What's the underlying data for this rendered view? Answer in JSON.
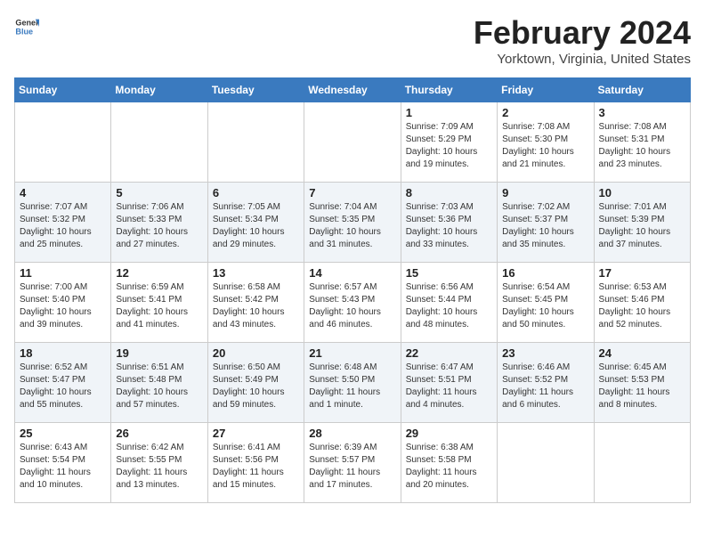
{
  "header": {
    "logo_general": "General",
    "logo_blue": "Blue",
    "title": "February 2024",
    "location": "Yorktown, Virginia, United States"
  },
  "weekdays": [
    "Sunday",
    "Monday",
    "Tuesday",
    "Wednesday",
    "Thursday",
    "Friday",
    "Saturday"
  ],
  "weeks": [
    [
      {
        "day": "",
        "info": ""
      },
      {
        "day": "",
        "info": ""
      },
      {
        "day": "",
        "info": ""
      },
      {
        "day": "",
        "info": ""
      },
      {
        "day": "1",
        "info": "Sunrise: 7:09 AM\nSunset: 5:29 PM\nDaylight: 10 hours\nand 19 minutes."
      },
      {
        "day": "2",
        "info": "Sunrise: 7:08 AM\nSunset: 5:30 PM\nDaylight: 10 hours\nand 21 minutes."
      },
      {
        "day": "3",
        "info": "Sunrise: 7:08 AM\nSunset: 5:31 PM\nDaylight: 10 hours\nand 23 minutes."
      }
    ],
    [
      {
        "day": "4",
        "info": "Sunrise: 7:07 AM\nSunset: 5:32 PM\nDaylight: 10 hours\nand 25 minutes."
      },
      {
        "day": "5",
        "info": "Sunrise: 7:06 AM\nSunset: 5:33 PM\nDaylight: 10 hours\nand 27 minutes."
      },
      {
        "day": "6",
        "info": "Sunrise: 7:05 AM\nSunset: 5:34 PM\nDaylight: 10 hours\nand 29 minutes."
      },
      {
        "day": "7",
        "info": "Sunrise: 7:04 AM\nSunset: 5:35 PM\nDaylight: 10 hours\nand 31 minutes."
      },
      {
        "day": "8",
        "info": "Sunrise: 7:03 AM\nSunset: 5:36 PM\nDaylight: 10 hours\nand 33 minutes."
      },
      {
        "day": "9",
        "info": "Sunrise: 7:02 AM\nSunset: 5:37 PM\nDaylight: 10 hours\nand 35 minutes."
      },
      {
        "day": "10",
        "info": "Sunrise: 7:01 AM\nSunset: 5:39 PM\nDaylight: 10 hours\nand 37 minutes."
      }
    ],
    [
      {
        "day": "11",
        "info": "Sunrise: 7:00 AM\nSunset: 5:40 PM\nDaylight: 10 hours\nand 39 minutes."
      },
      {
        "day": "12",
        "info": "Sunrise: 6:59 AM\nSunset: 5:41 PM\nDaylight: 10 hours\nand 41 minutes."
      },
      {
        "day": "13",
        "info": "Sunrise: 6:58 AM\nSunset: 5:42 PM\nDaylight: 10 hours\nand 43 minutes."
      },
      {
        "day": "14",
        "info": "Sunrise: 6:57 AM\nSunset: 5:43 PM\nDaylight: 10 hours\nand 46 minutes."
      },
      {
        "day": "15",
        "info": "Sunrise: 6:56 AM\nSunset: 5:44 PM\nDaylight: 10 hours\nand 48 minutes."
      },
      {
        "day": "16",
        "info": "Sunrise: 6:54 AM\nSunset: 5:45 PM\nDaylight: 10 hours\nand 50 minutes."
      },
      {
        "day": "17",
        "info": "Sunrise: 6:53 AM\nSunset: 5:46 PM\nDaylight: 10 hours\nand 52 minutes."
      }
    ],
    [
      {
        "day": "18",
        "info": "Sunrise: 6:52 AM\nSunset: 5:47 PM\nDaylight: 10 hours\nand 55 minutes."
      },
      {
        "day": "19",
        "info": "Sunrise: 6:51 AM\nSunset: 5:48 PM\nDaylight: 10 hours\nand 57 minutes."
      },
      {
        "day": "20",
        "info": "Sunrise: 6:50 AM\nSunset: 5:49 PM\nDaylight: 10 hours\nand 59 minutes."
      },
      {
        "day": "21",
        "info": "Sunrise: 6:48 AM\nSunset: 5:50 PM\nDaylight: 11 hours\nand 1 minute."
      },
      {
        "day": "22",
        "info": "Sunrise: 6:47 AM\nSunset: 5:51 PM\nDaylight: 11 hours\nand 4 minutes."
      },
      {
        "day": "23",
        "info": "Sunrise: 6:46 AM\nSunset: 5:52 PM\nDaylight: 11 hours\nand 6 minutes."
      },
      {
        "day": "24",
        "info": "Sunrise: 6:45 AM\nSunset: 5:53 PM\nDaylight: 11 hours\nand 8 minutes."
      }
    ],
    [
      {
        "day": "25",
        "info": "Sunrise: 6:43 AM\nSunset: 5:54 PM\nDaylight: 11 hours\nand 10 minutes."
      },
      {
        "day": "26",
        "info": "Sunrise: 6:42 AM\nSunset: 5:55 PM\nDaylight: 11 hours\nand 13 minutes."
      },
      {
        "day": "27",
        "info": "Sunrise: 6:41 AM\nSunset: 5:56 PM\nDaylight: 11 hours\nand 15 minutes."
      },
      {
        "day": "28",
        "info": "Sunrise: 6:39 AM\nSunset: 5:57 PM\nDaylight: 11 hours\nand 17 minutes."
      },
      {
        "day": "29",
        "info": "Sunrise: 6:38 AM\nSunset: 5:58 PM\nDaylight: 11 hours\nand 20 minutes."
      },
      {
        "day": "",
        "info": ""
      },
      {
        "day": "",
        "info": ""
      }
    ]
  ]
}
